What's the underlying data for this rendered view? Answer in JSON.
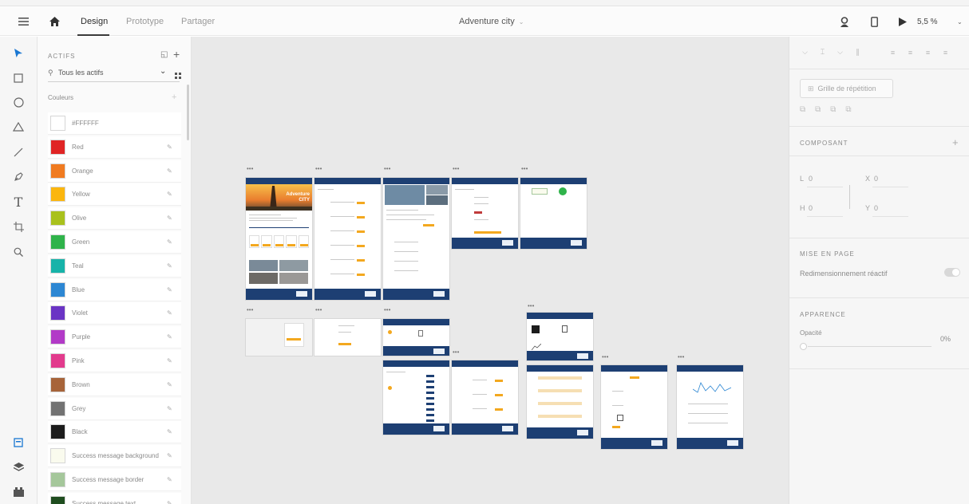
{
  "topbar": {
    "tabs": [
      {
        "label": "Design"
      },
      {
        "label": "Prototype"
      },
      {
        "label": "Partager"
      }
    ],
    "document_title": "Adventure city",
    "zoom": "5,5 %"
  },
  "assets": {
    "section_title": "ACTIFS",
    "search_placeholder": "Tous les actifs",
    "colors_title": "Couleurs",
    "colors": [
      {
        "name": "#FFFFFF",
        "hex": "#ffffff"
      },
      {
        "name": "Red",
        "hex": "#e02525"
      },
      {
        "name": "Orange",
        "hex": "#f07b21"
      },
      {
        "name": "Yellow",
        "hex": "#fbb60e"
      },
      {
        "name": "Olive",
        "hex": "#a9c11d"
      },
      {
        "name": "Green",
        "hex": "#2fb34a"
      },
      {
        "name": "Teal",
        "hex": "#17b3a9"
      },
      {
        "name": "Blue",
        "hex": "#2d87d3"
      },
      {
        "name": "Violet",
        "hex": "#6a34c4"
      },
      {
        "name": "Purple",
        "hex": "#b23ac7"
      },
      {
        "name": "Pink",
        "hex": "#e23b8d"
      },
      {
        "name": "Brown",
        "hex": "#a7643a"
      },
      {
        "name": "Grey",
        "hex": "#727272"
      },
      {
        "name": "Black",
        "hex": "#1c1c1c"
      },
      {
        "name": "Success message background",
        "hex": "#fafbee"
      },
      {
        "name": "Success message border",
        "hex": "#a5c79b"
      },
      {
        "name": "Success message text",
        "hex": "#1f4d1f"
      }
    ]
  },
  "canvas": {
    "hero_title": "Adventure",
    "hero_subtitle": "CITY",
    "artboard_menu": "•••"
  },
  "props": {
    "repeat_grid": "Grille de répétition",
    "component_title": "COMPOSANT",
    "w_label": "L",
    "w_value": "0",
    "h_label": "H",
    "h_value": "0",
    "x_label": "X",
    "x_value": "0",
    "y_label": "Y",
    "y_value": "0",
    "layout_title": "MISE EN PAGE",
    "responsive_label": "Redimensionnement réactif",
    "appearance_title": "APPARENCE",
    "opacity_label": "Opacité",
    "opacity_value": "0%"
  }
}
